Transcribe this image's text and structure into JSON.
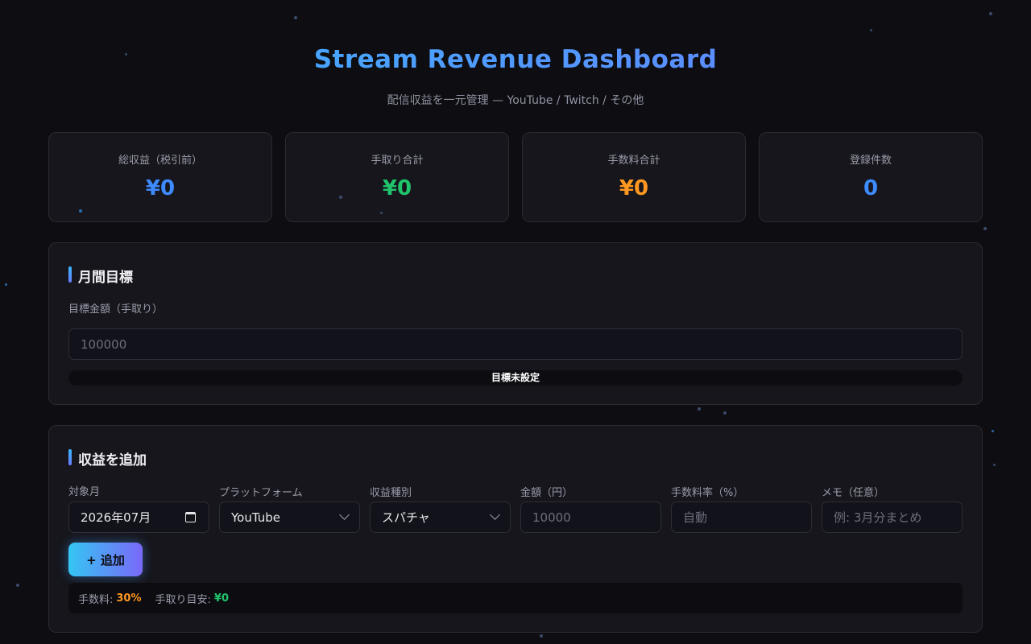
{
  "header": {
    "title": "Stream Revenue Dashboard",
    "subtitle": "配信収益を一元管理 — YouTube / Twitch / その他"
  },
  "stats": [
    {
      "label": "総収益（税引前）",
      "value": "¥0",
      "color": "#3d8bff"
    },
    {
      "label": "手取り合計",
      "value": "¥0",
      "color": "#1fc46b"
    },
    {
      "label": "手数料合計",
      "value": "¥0",
      "color": "#ff9820"
    },
    {
      "label": "登録件数",
      "value": "0",
      "color": "#3d8bff"
    }
  ],
  "goal": {
    "title": "月間目標",
    "label": "目標金額（手取り）",
    "placeholder": "100000",
    "status": "目標未設定"
  },
  "add_form": {
    "title": "収益を追加",
    "month_label": "対象月",
    "month_value": "2026年07月",
    "platform_label": "プラットフォーム",
    "platform_value": "YouTube",
    "type_label": "収益種別",
    "type_value": "スパチャ",
    "amount_label": "金額（円）",
    "amount_placeholder": "10000",
    "fee_label": "手数料率（%）",
    "fee_placeholder": "自動",
    "memo_label": "メモ（任意）",
    "memo_placeholder": "例: 3月分まとめ",
    "add_button": "+ 追加",
    "fee_info_label": "手数料:",
    "fee_info_value": "30%",
    "net_info_label": "手取り目安:",
    "net_info_value": "¥0"
  },
  "colors": {
    "accent_blue": "#3d8bff",
    "accent_green": "#1fc46b",
    "accent_orange": "#ff9820"
  }
}
